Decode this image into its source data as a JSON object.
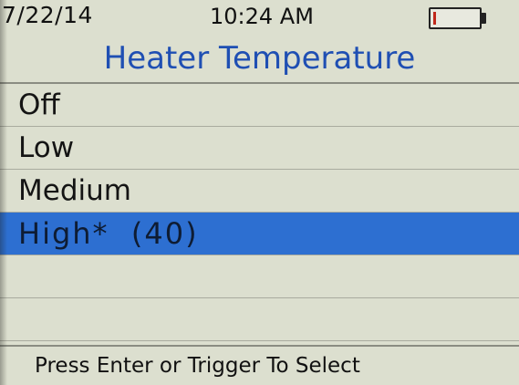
{
  "status_bar": {
    "date": "7/22/14",
    "time": "10:24 AM",
    "battery_icon": "battery-low-icon",
    "battery_level_fraction": 0.05,
    "battery_fill_color": "#c0281b"
  },
  "title": "Heater Temperature",
  "colors": {
    "title": "#1f4fb3",
    "selection": "#2d6fd1",
    "background": "#dcdfcf"
  },
  "menu": {
    "items": [
      {
        "label": "Off",
        "selected": false
      },
      {
        "label": "Low",
        "selected": false
      },
      {
        "label": "Medium",
        "selected": false
      },
      {
        "label": "High*  (40)",
        "selected": true
      }
    ]
  },
  "footer": {
    "hint": "Press Enter or Trigger To Select"
  }
}
